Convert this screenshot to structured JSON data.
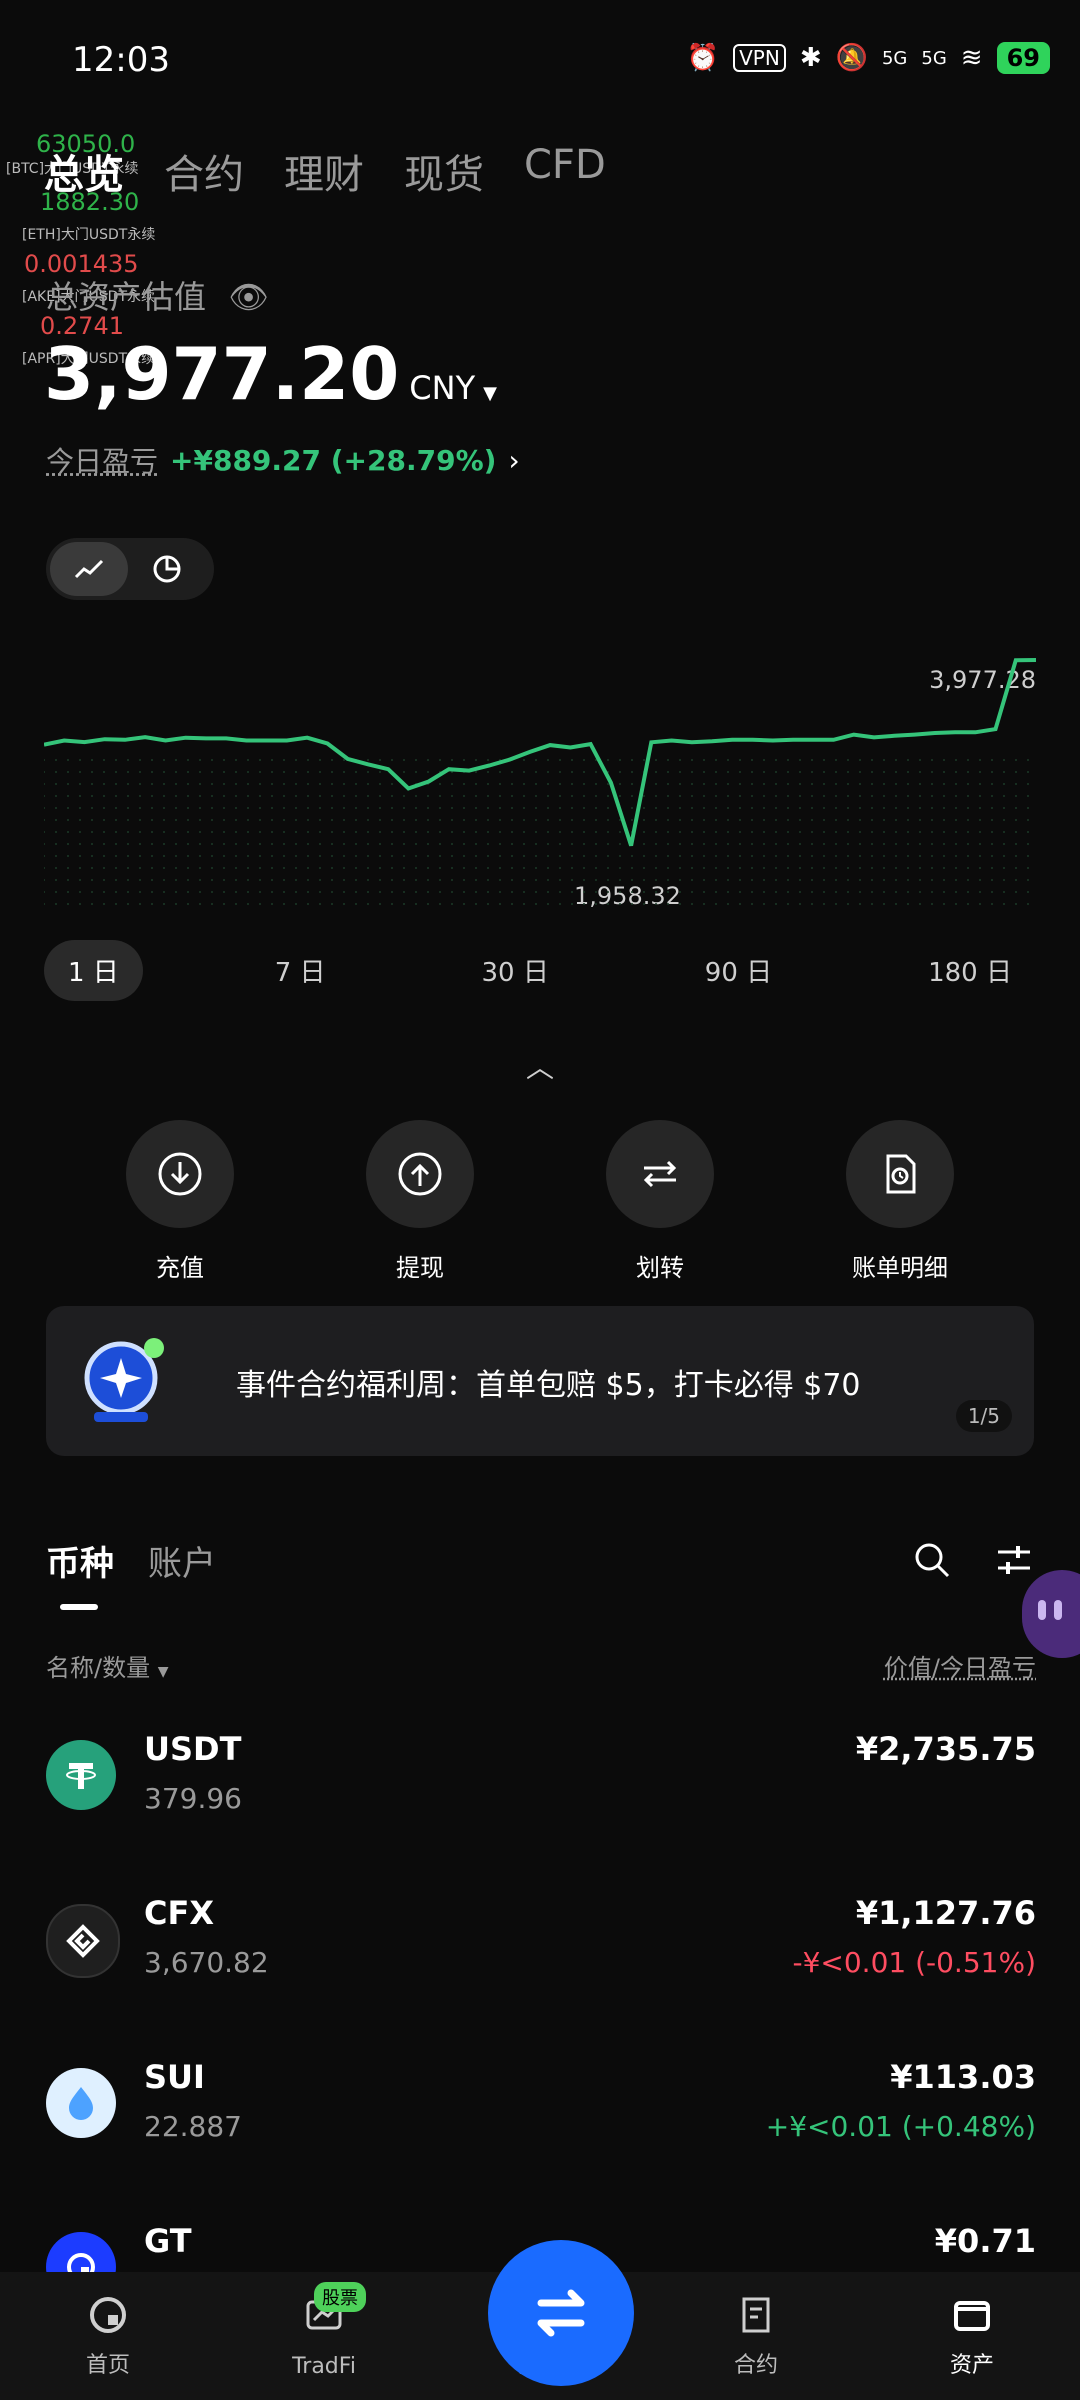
{
  "status_bar": {
    "time": "12:03",
    "signal_5g_1": "5G",
    "signal_5g_2": "5G",
    "vpn": "VPN",
    "battery": "69"
  },
  "ticker": {
    "btc_price": "63050.0",
    "btc_label": "[BTC]大门USDT永续",
    "eth_price": "1882.30",
    "eth_label": "[ETH]大门USDT永续",
    "ake_price": "0.001435",
    "ake_label": "[AKE]大门USDT永续",
    "apr_price": "0.2741",
    "apr_label": "[APR]大门USDT永续"
  },
  "tabs": [
    "总览",
    "合约",
    "理财",
    "现货",
    "CFD"
  ],
  "summary": {
    "label": "总资产估值",
    "value": "3,977.20",
    "currency": "CNY",
    "pnl_label": "今日盈亏",
    "pnl_value": "+¥889.27 (+28.79%)"
  },
  "chart": {
    "max_label": "3,977.28",
    "min_label": "1,958.32",
    "line_color": "#35c47a"
  },
  "chart_data": {
    "type": "line",
    "x": [
      "0",
      "1",
      "2",
      "3",
      "4",
      "5",
      "6",
      "7",
      "8",
      "9",
      "10",
      "11",
      "12",
      "13",
      "14",
      "15",
      "16",
      "17",
      "18",
      "19",
      "20",
      "21",
      "22",
      "23",
      "24",
      "25",
      "26",
      "27",
      "28",
      "29",
      "30",
      "31",
      "32",
      "33",
      "34",
      "35",
      "36",
      "37",
      "38",
      "39",
      "40",
      "41",
      "42",
      "43",
      "44",
      "45",
      "46",
      "47",
      "48",
      "49"
    ],
    "values": [
      3265,
      3300,
      3287,
      3311,
      3306,
      3328,
      3300,
      3324,
      3318,
      3318,
      3300,
      3300,
      3300,
      3324,
      3275,
      3145,
      3100,
      3059,
      2896,
      2955,
      3059,
      3047,
      3090,
      3139,
      3204,
      3261,
      3241,
      3270,
      2945,
      2416,
      3285,
      3300,
      3285,
      3293,
      3306,
      3306,
      3300,
      3306,
      3306,
      3306,
      3350,
      3326,
      3340,
      3350,
      3363,
      3370,
      3369,
      3396,
      3976,
      3977
    ],
    "ylim": [
      1958.32,
      3977.28
    ]
  },
  "range_options": [
    "1 日",
    "7 日",
    "30 日",
    "90 日",
    "180 日"
  ],
  "actions": [
    {
      "label": "充值",
      "icon": "deposit-icon"
    },
    {
      "label": "提现",
      "icon": "withdraw-icon"
    },
    {
      "label": "划转",
      "icon": "transfer-icon"
    },
    {
      "label": "账单明细",
      "icon": "bill-icon"
    }
  ],
  "banner": {
    "text": "事件合约福利周：首单包赔 $5，打卡必得 $70",
    "page": "1/5"
  },
  "asset_tabs": [
    "币种",
    "账户"
  ],
  "list_header": {
    "left": "名称/数量",
    "right": "价值/今日盈亏"
  },
  "coins": [
    {
      "symbol": "USDT",
      "qty": "379.96",
      "value": "¥2,735.75",
      "pnl": "",
      "pnl_color": "#9a9a9a",
      "logo_color": "#26a17b"
    },
    {
      "symbol": "CFX",
      "qty": "3,670.82",
      "value": "¥1,127.76",
      "pnl": "-¥<0.01 (-0.51%)",
      "pnl_color": "#ff4d61",
      "logo_color": "#1f1f1f"
    },
    {
      "symbol": "SUI",
      "qty": "22.887",
      "value": "¥113.03",
      "pnl": "+¥<0.01 (+0.48%)",
      "pnl_color": "#35c47a",
      "logo_color": "#dff0ff"
    },
    {
      "symbol": "GT",
      "qty": "",
      "value": "¥0.71",
      "pnl": "",
      "pnl_color": "#9a9a9a",
      "logo_color": "#1c3cff"
    }
  ],
  "bottom_nav": [
    {
      "label": "首页",
      "icon": "home-icon"
    },
    {
      "label": "TradFi",
      "icon": "tradfi-icon",
      "badge": "股票"
    },
    {
      "label": "交易",
      "icon": "trade-icon"
    },
    {
      "label": "合约",
      "icon": "contract-icon"
    },
    {
      "label": "资产",
      "icon": "wallet-icon"
    }
  ]
}
